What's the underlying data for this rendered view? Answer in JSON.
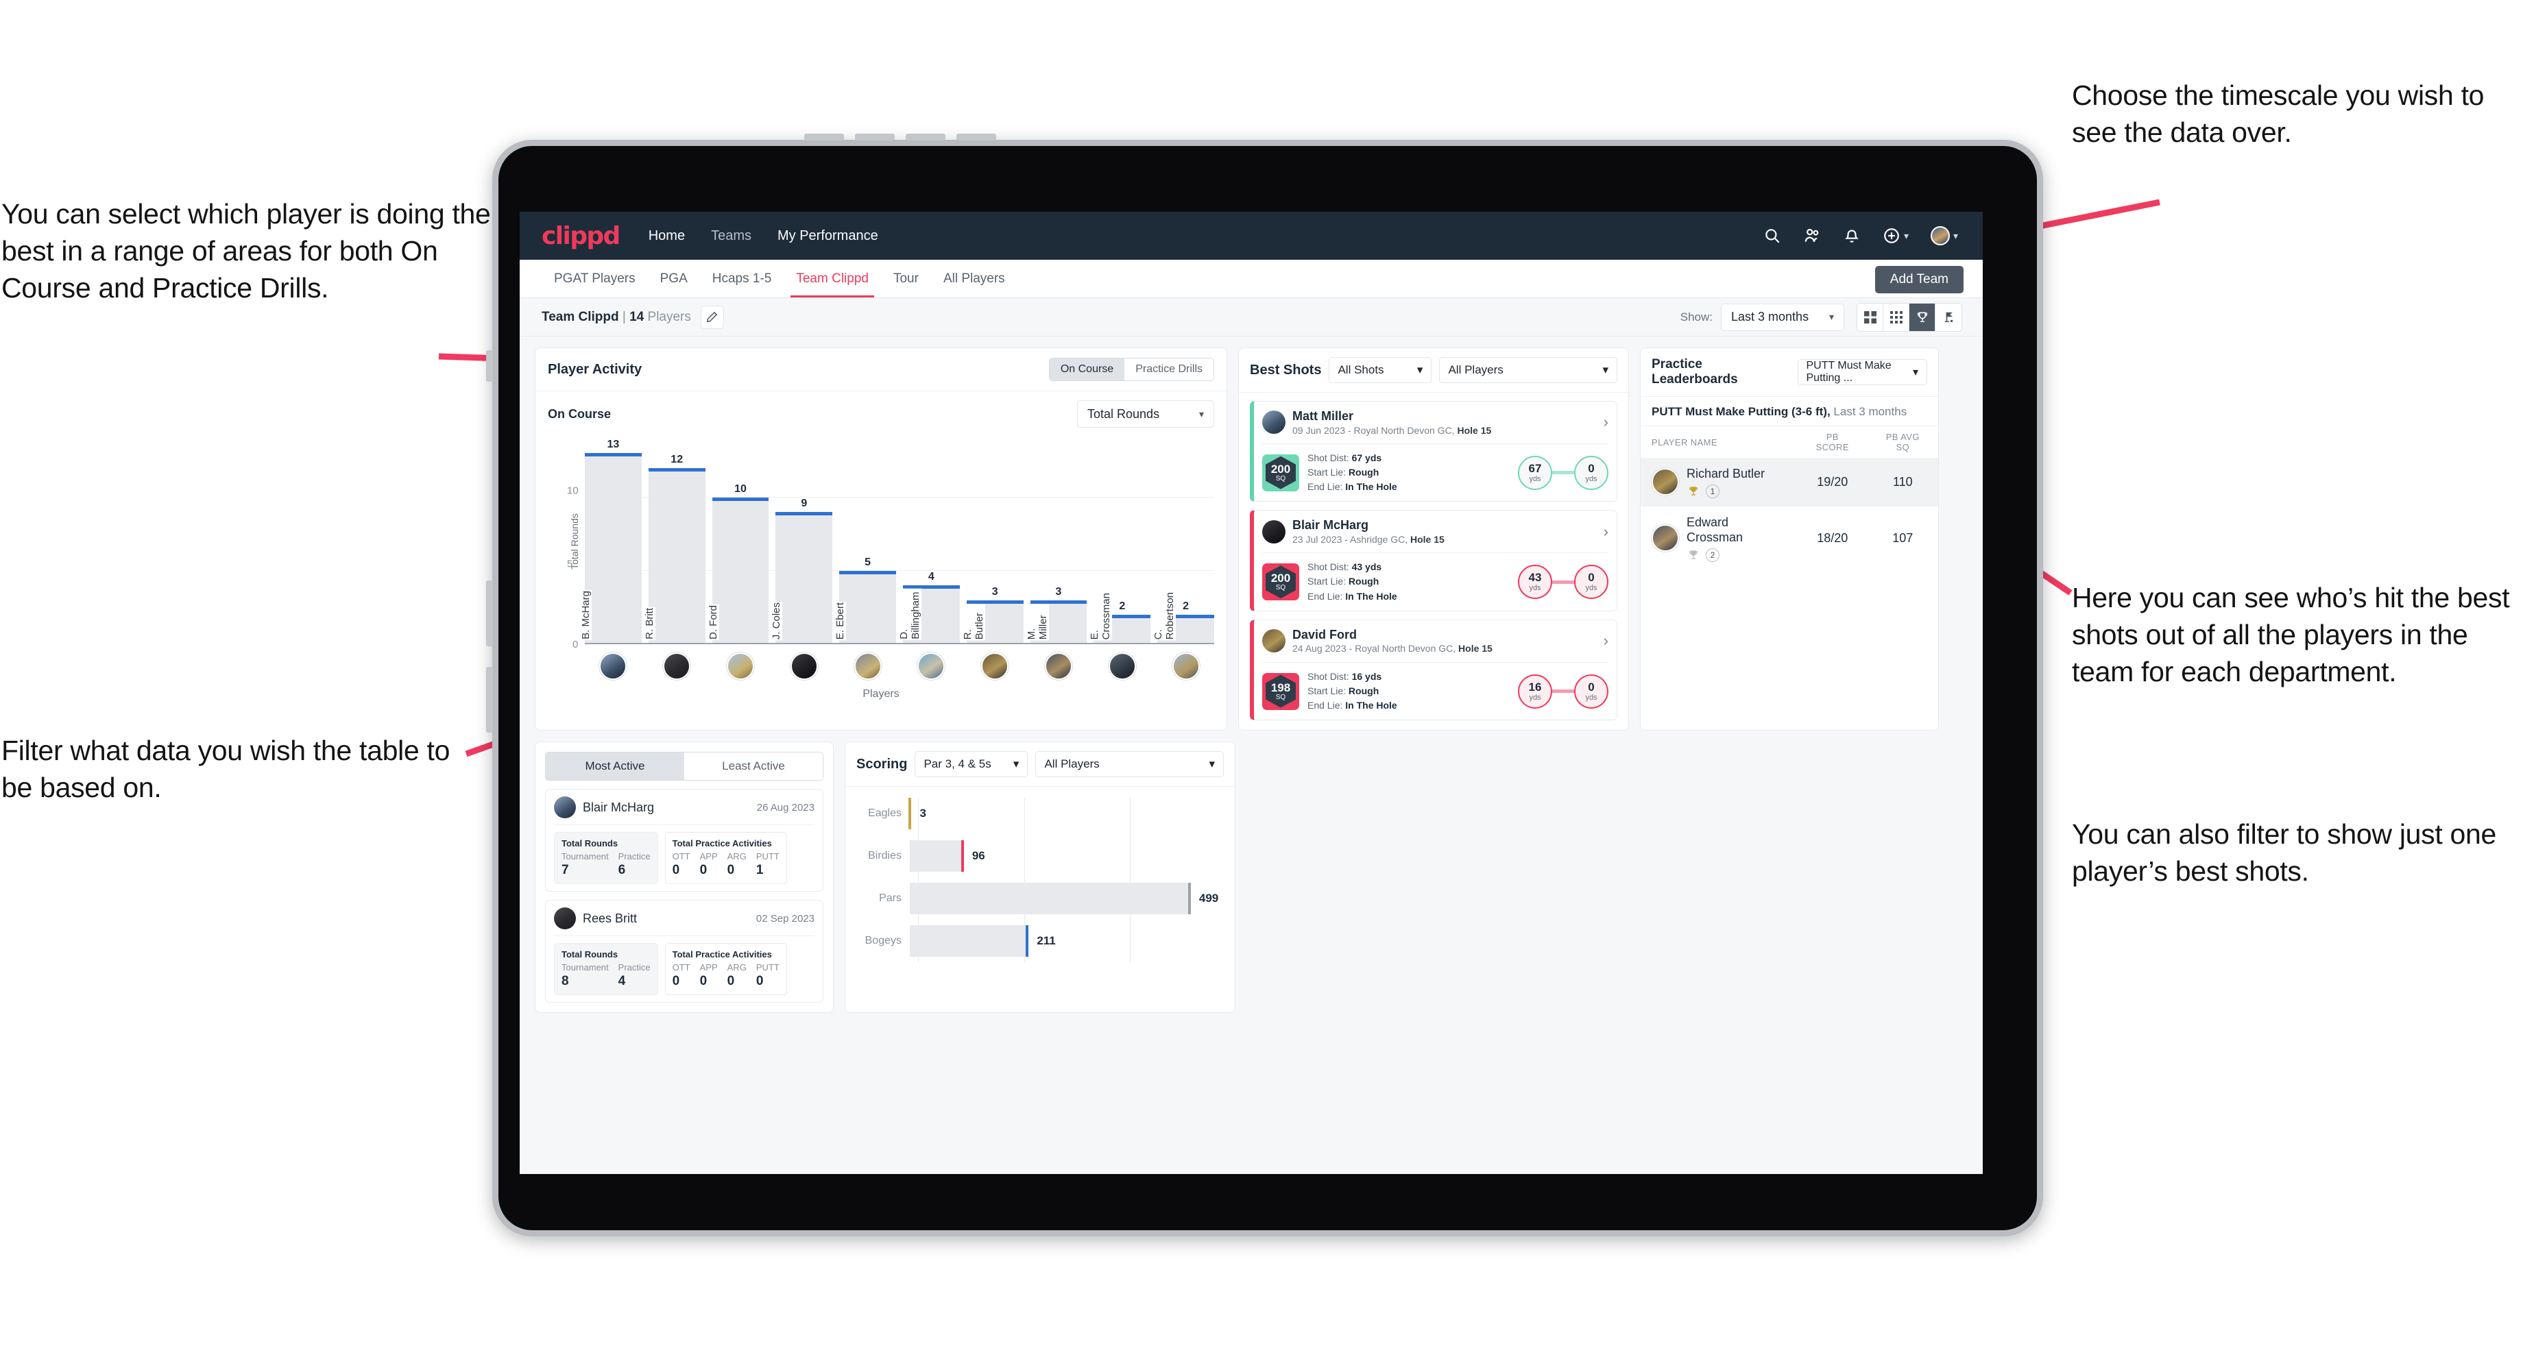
{
  "annotations": {
    "left_top": "You can select which player is doing the best in a range of areas for both On Course and Practice Drills.",
    "left_bottom": "Filter what data you wish the table to be based on.",
    "right_top": "Choose the timescale you wish to see the data over.",
    "right_mid": "Here you can see who’s hit the best shots out of all the players in the team for each department.",
    "right_bottom": "You can also filter to show just one player’s best shots."
  },
  "topnav": {
    "brand": "clippd",
    "links": [
      {
        "label": "Home",
        "active": true
      },
      {
        "label": "Teams",
        "active": false
      },
      {
        "label": "My Performance",
        "active": false
      }
    ],
    "icons": [
      "search-icon",
      "people-icon",
      "bell-icon",
      "plus-circle-icon",
      "avatar"
    ]
  },
  "tabs": [
    {
      "label": "PGAT Players",
      "active": false
    },
    {
      "label": "PGA",
      "active": false
    },
    {
      "label": "Hcaps 1-5",
      "active": false
    },
    {
      "label": "Team Clippd",
      "active": true
    },
    {
      "label": "Tour",
      "active": false
    },
    {
      "label": "All Players",
      "active": false
    }
  ],
  "add_team_label": "Add Team",
  "subbar": {
    "team_name": "Team Clippd",
    "separator": "|",
    "player_count": "14",
    "players_word": "Players",
    "edit_icon": "pencil-icon",
    "show_label": "Show:",
    "timescale_value": "Last 3 months",
    "view_icons": [
      {
        "name": "grid-2x2-icon",
        "active": false
      },
      {
        "name": "grid-3x3-icon",
        "active": false
      },
      {
        "name": "trophy-icon",
        "active": true
      },
      {
        "name": "golf-flag-icon",
        "active": false
      }
    ]
  },
  "player_activity": {
    "title": "Player Activity",
    "segmented": [
      {
        "label": "On Course",
        "active": true
      },
      {
        "label": "Practice Drills",
        "active": false
      }
    ],
    "sub_label": "On Course",
    "metric_value": "Total Rounds"
  },
  "best_shots": {
    "title": "Best Shots",
    "shot_filter": "All Shots",
    "player_filter": "All Players",
    "cards": [
      {
        "name": "Matt Miller",
        "meta_date": "09 Jun 2023 - Royal North Devon GC,",
        "meta_hole": "Hole 15",
        "accent": "green",
        "sq_value": "200",
        "sq_unit": "SQ",
        "shot_dist_label": "Shot Dist:",
        "shot_dist": "67 yds",
        "start_lie_label": "Start Lie:",
        "start_lie": "Rough",
        "end_lie_label": "End Lie:",
        "end_lie": "In The Hole",
        "from_value": "67",
        "from_unit": "yds",
        "to_value": "0",
        "to_unit": "yds"
      },
      {
        "name": "Blair McHarg",
        "meta_date": "23 Jul 2023 - Ashridge GC,",
        "meta_hole": "Hole 15",
        "accent": "pink",
        "sq_value": "200",
        "sq_unit": "SQ",
        "shot_dist_label": "Shot Dist:",
        "shot_dist": "43 yds",
        "start_lie_label": "Start Lie:",
        "start_lie": "Rough",
        "end_lie_label": "End Lie:",
        "end_lie": "In The Hole",
        "from_value": "43",
        "from_unit": "yds",
        "to_value": "0",
        "to_unit": "yds"
      },
      {
        "name": "David Ford",
        "meta_date": "24 Aug 2023 - Royal North Devon GC,",
        "meta_hole": "Hole 15",
        "accent": "pink",
        "sq_value": "198",
        "sq_unit": "SQ",
        "shot_dist_label": "Shot Dist:",
        "shot_dist": "16 yds",
        "start_lie_label": "Start Lie:",
        "start_lie": "Rough",
        "end_lie_label": "End Lie:",
        "end_lie": "In The Hole",
        "from_value": "16",
        "from_unit": "yds",
        "to_value": "0",
        "to_unit": "yds"
      }
    ]
  },
  "practice_leaderboards": {
    "title": "Practice Leaderboards",
    "drill_filter": "PUTT Must Make Putting ...",
    "subtitle_bold": "PUTT Must Make Putting (3-6 ft),",
    "subtitle_dim": "Last 3 months",
    "columns": [
      "PLAYER NAME",
      "PB SCORE",
      "PB AVG SQ"
    ],
    "rows": [
      {
        "name": "Richard Butler",
        "rank": "1",
        "trophy": "gold",
        "pb_score": "19/20",
        "pb_avg_sq": "110",
        "highlight": true
      },
      {
        "name": "Edward Crossman",
        "rank": "2",
        "trophy": "silver",
        "pb_score": "18/20",
        "pb_avg_sq": "107",
        "highlight": false
      }
    ]
  },
  "activity": {
    "tabs": [
      {
        "label": "Most Active",
        "active": true
      },
      {
        "label": "Least Active",
        "active": false
      }
    ],
    "cards": [
      {
        "name": "Blair McHarg",
        "date": "26 Aug 2023",
        "rounds_title": "Total Rounds",
        "rounds": [
          {
            "label": "Tournament",
            "value": "7"
          },
          {
            "label": "Practice",
            "value": "6"
          }
        ],
        "practice_title": "Total Practice Activities",
        "practice": [
          {
            "label": "OTT",
            "value": "0"
          },
          {
            "label": "APP",
            "value": "0"
          },
          {
            "label": "ARG",
            "value": "0"
          },
          {
            "label": "PUTT",
            "value": "1"
          }
        ]
      },
      {
        "name": "Rees Britt",
        "date": "02 Sep 2023",
        "rounds_title": "Total Rounds",
        "rounds": [
          {
            "label": "Tournament",
            "value": "8"
          },
          {
            "label": "Practice",
            "value": "4"
          }
        ],
        "practice_title": "Total Practice Activities",
        "practice": [
          {
            "label": "OTT",
            "value": "0"
          },
          {
            "label": "APP",
            "value": "0"
          },
          {
            "label": "ARG",
            "value": "0"
          },
          {
            "label": "PUTT",
            "value": "0"
          }
        ]
      }
    ]
  },
  "scoring": {
    "title": "Scoring",
    "par_filter": "Par 3, 4 & 5s",
    "player_filter": "All Players"
  },
  "chart_data": [
    {
      "type": "bar",
      "title": "Player Activity — On Course",
      "xlabel": "Players",
      "ylabel": "Total Rounds",
      "ylim": [
        0,
        14
      ],
      "yticks": [
        0,
        5,
        10
      ],
      "grid": true,
      "categories": [
        "B. McHarg",
        "R. Britt",
        "D. Ford",
        "J. Coles",
        "E. Ebert",
        "D. Billingham",
        "R. Butler",
        "M. Miller",
        "E. Crossman",
        "C. Robertson"
      ],
      "values": [
        13,
        12,
        10,
        9,
        5,
        4,
        3,
        3,
        2,
        2
      ],
      "bar_color": "#e6e8ec",
      "cap_color": "#2f72cf"
    },
    {
      "type": "bar",
      "orientation": "horizontal",
      "title": "Scoring",
      "categories": [
        "Eagles",
        "Birdies",
        "Pars",
        "Bogeys"
      ],
      "values": [
        3,
        96,
        499,
        211
      ],
      "xlim": [
        0,
        560
      ],
      "colors": [
        "#c7a545",
        "#ee3a5c",
        "#9aa1a9",
        "#2f72cf"
      ],
      "grid": true
    }
  ]
}
